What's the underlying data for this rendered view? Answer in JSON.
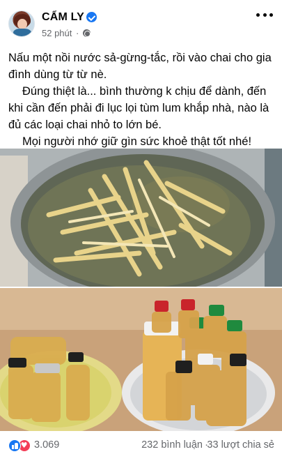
{
  "post": {
    "author": "CẨM LY",
    "time": "52 phút",
    "separator": "·",
    "paragraphs": [
      "Nấu một nồi nước sả-gừng-tắc, rồi vào chai cho gia đình dùng từ từ nè.",
      "Đúng thiệt là... bình thường k chịu để dành, đến khi cần đến phải đi lục lọi tùm lum khắp nhà, nào là đủ các loại chai nhỏ to lớn bé.",
      "Mọi người nhớ giữ gìn sức khoẻ thật tốt nhé!"
    ]
  },
  "stats": {
    "reactions": "3.069",
    "comments": "232 bình luận",
    "dot": "·",
    "shares": "33 lượt chia sẻ"
  },
  "icons": {
    "verified": "verified-badge-icon",
    "audience": "globe-icon",
    "menu": "more-options-icon",
    "reaction_1": "like-icon",
    "reaction_2": "love-icon"
  },
  "colors": {
    "accent": "#1877f2",
    "love": "#f33e58",
    "secondary_text": "#65676b"
  }
}
